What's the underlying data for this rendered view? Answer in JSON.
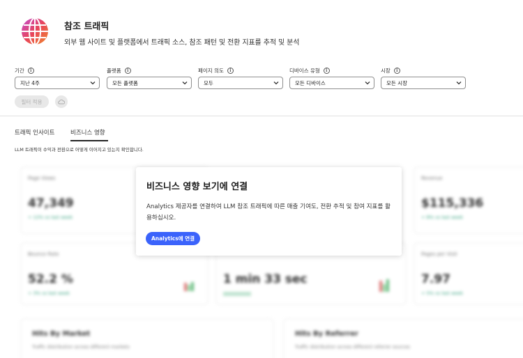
{
  "header": {
    "title": "참조 트래픽",
    "subtitle": "외부 웹 사이트 및 플랫폼에서 트래픽 소스, 참조 패턴 및 전환 지표를 추적 및 분석",
    "logo_icon": "globe-icon"
  },
  "filters": [
    {
      "label": "기간",
      "value": "지난 4주"
    },
    {
      "label": "플랫폼",
      "value": "모든 플랫폼"
    },
    {
      "label": "페이지 의도",
      "value": "모두"
    },
    {
      "label": "디바이스 유형",
      "value": "모든 디바이스"
    },
    {
      "label": "시장",
      "value": "모든 시장"
    }
  ],
  "actions": {
    "apply_label": "필터 적용",
    "cloud_icon": "cloud-icon"
  },
  "tabs": [
    {
      "label": "트래픽 인사이트",
      "active": false
    },
    {
      "label": "비즈니스 영향",
      "active": true
    }
  ],
  "tab_description": "LLM 트래픽이 수익과 전환으로 어떻게 이어지고 있는지 확인합니다.",
  "blurred_cards": {
    "page_views": {
      "label": "Page Views",
      "value": "47,349",
      "change": "+ 12% vs last week"
    },
    "revenue": {
      "label": "Revenue",
      "value": "$115,336",
      "change": "+ 8% vs last week"
    },
    "bounce_rate": {
      "label": "Bounce Rate",
      "value": "52.2 %",
      "change": "+ 3% vs last week"
    },
    "time_on_page": {
      "value": "1 min 33 sec"
    },
    "pages_per_visit": {
      "label": "Pages per Visit",
      "value": "7.97",
      "change": "+ 5% vs last week"
    },
    "hits_by_market": {
      "title": "Hits By Market",
      "subtitle": "Traffic distribution across different markets"
    },
    "hits_by_referrer": {
      "title": "Hits By Referrer",
      "subtitle": "Traffic distribution across different referrer sources"
    }
  },
  "overlay": {
    "title": "비즈니스 영향 보기에 연결",
    "body": "Analytics 제공자를 연결하여 LLM 참조 트래픽에 따른 매출 기여도, 전환 추적 및 참여 지표를 활용하십시오.",
    "button_label": "Analytics에 연결"
  },
  "colors": {
    "accent": "#3b63fb",
    "positive": "#2d9d78",
    "logo_gradient": [
      "#d94a6a",
      "#ea6b3a",
      "#9b4fd0"
    ]
  }
}
